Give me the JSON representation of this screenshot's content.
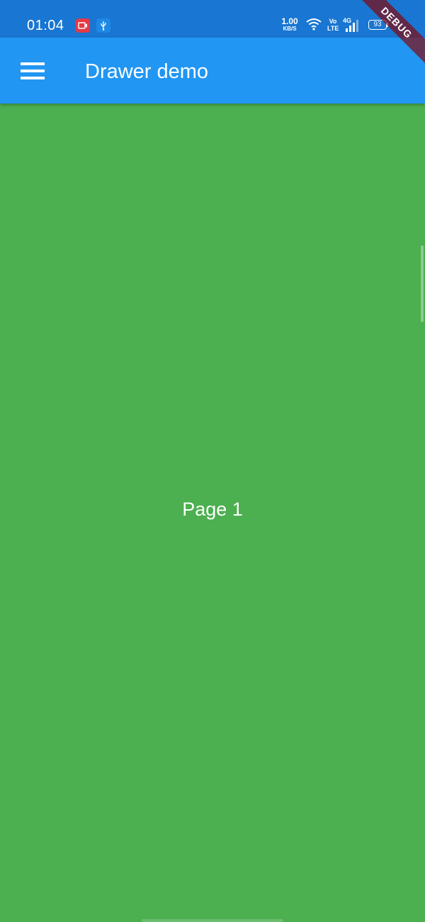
{
  "status_bar": {
    "time": "01:04",
    "notifications": [
      {
        "icon": "screen-record-icon",
        "color": "#E53946"
      },
      {
        "icon": "usb-icon",
        "color": "#1E88E5"
      }
    ],
    "net_speed_value": "1.00",
    "net_speed_unit": "KB/S",
    "wifi": "wifi-icon",
    "volte_line1": "Vo",
    "volte_line2": "LTE",
    "network_type": "4G",
    "battery_level": "93"
  },
  "app_bar": {
    "title": "Drawer demo",
    "menu_icon": "hamburger-menu-icon",
    "color": "#2196F3"
  },
  "page": {
    "label": "Page 1",
    "background": "#4CAF50"
  },
  "debug_banner": {
    "label": "DEBUG"
  }
}
